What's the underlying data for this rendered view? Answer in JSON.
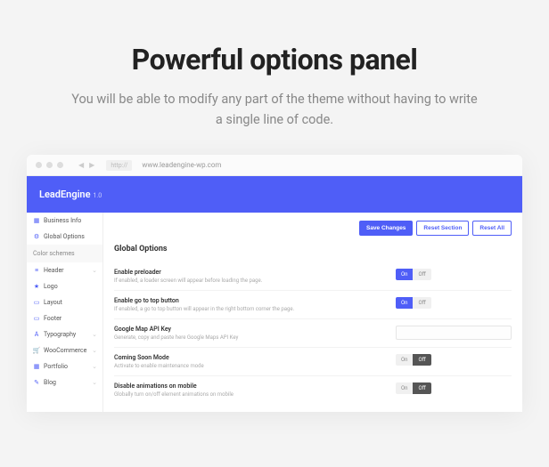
{
  "hero": {
    "title": "Powerful options panel",
    "subtitle": "You will be able to modify any part of the theme without having to write a single line of code."
  },
  "browser": {
    "protocol": "http://",
    "url": "www.leadengine-wp.com"
  },
  "panel": {
    "brand": "LeadEngine",
    "version": "1.0"
  },
  "sidebar": {
    "items": [
      {
        "icon": "▦",
        "label": "Business Info",
        "type": "item"
      },
      {
        "icon": "⚙",
        "label": "Global Options",
        "type": "item"
      },
      {
        "icon": "",
        "label": "Color schemes",
        "type": "section"
      },
      {
        "icon": "≡",
        "label": "Header",
        "type": "expandable"
      },
      {
        "icon": "★",
        "label": "Logo",
        "type": "item"
      },
      {
        "icon": "▭",
        "label": "Layout",
        "type": "item"
      },
      {
        "icon": "▭",
        "label": "Footer",
        "type": "item"
      },
      {
        "icon": "A",
        "label": "Typography",
        "type": "expandable"
      },
      {
        "icon": "🛒",
        "label": "WooCommerce",
        "type": "expandable"
      },
      {
        "icon": "▦",
        "label": "Portfolio",
        "type": "expandable"
      },
      {
        "icon": "✎",
        "label": "Blog",
        "type": "expandable"
      }
    ]
  },
  "actions": {
    "save": "Save Changes",
    "reset_section": "Reset Section",
    "reset_all": "Reset All"
  },
  "content": {
    "heading": "Global Options",
    "options": [
      {
        "title": "Enable preloader",
        "desc": "If enabled, a loader screen will appear before loading the page.",
        "control": "toggle",
        "value": "on"
      },
      {
        "title": "Enable go to top button",
        "desc": "If enabled, a go to top button will appear in the right bottom corner the page.",
        "control": "toggle",
        "value": "on"
      },
      {
        "title": "Google Map API Key",
        "desc": "Generate, copy and paste here Google Maps API Key",
        "control": "text",
        "value": ""
      },
      {
        "title": "Coming Soon Mode",
        "desc": "Activate to enable maintenance mode",
        "control": "toggle",
        "value": "off"
      },
      {
        "title": "Disable animations on mobile",
        "desc": "Globally turn on/off element animations on mobile",
        "control": "toggle",
        "value": "off"
      }
    ],
    "toggle": {
      "on": "On",
      "off": "Off"
    }
  }
}
